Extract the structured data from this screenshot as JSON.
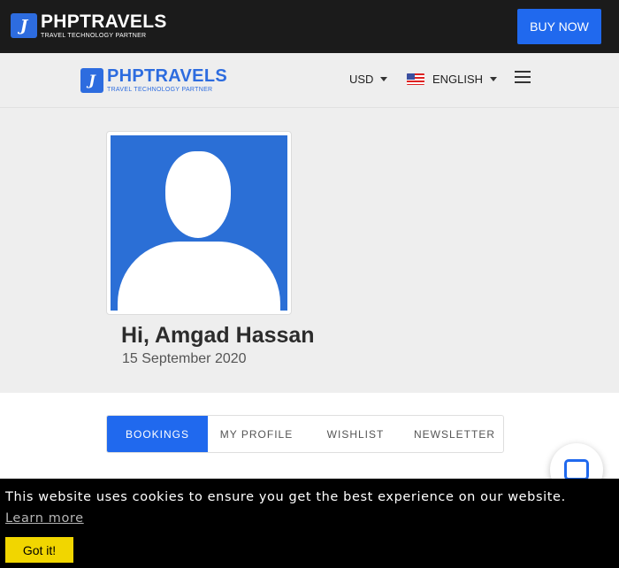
{
  "topbar": {
    "logo": {
      "name": "PHPTRAVELS",
      "tagline": "TRAVEL TECHNOLOGY PARTNER"
    },
    "buy_now": "BUY NOW"
  },
  "header": {
    "logo": {
      "name": "PHPTRAVELS",
      "tagline": "TRAVEL TECHNOLOGY PARTNER"
    },
    "currency": "USD",
    "language": "ENGLISH"
  },
  "profile": {
    "greeting": "Hi, Amgad Hassan",
    "date": "15 September 2020"
  },
  "tabs": [
    {
      "label": "BOOKINGS",
      "active": true
    },
    {
      "label": "MY PROFILE",
      "active": false
    },
    {
      "label": "WISHLIST",
      "active": false
    },
    {
      "label": "NEWSLETTER",
      "active": false
    }
  ],
  "cookie": {
    "message": "This website uses cookies to ensure you get the best experience on our website.",
    "learn_more": "Learn more",
    "accept": "Got it!"
  },
  "colors": {
    "accent": "#2069ee",
    "topbar": "#1b1b1b",
    "header": "#eeeeee",
    "cookie_button": "#f1d600"
  }
}
